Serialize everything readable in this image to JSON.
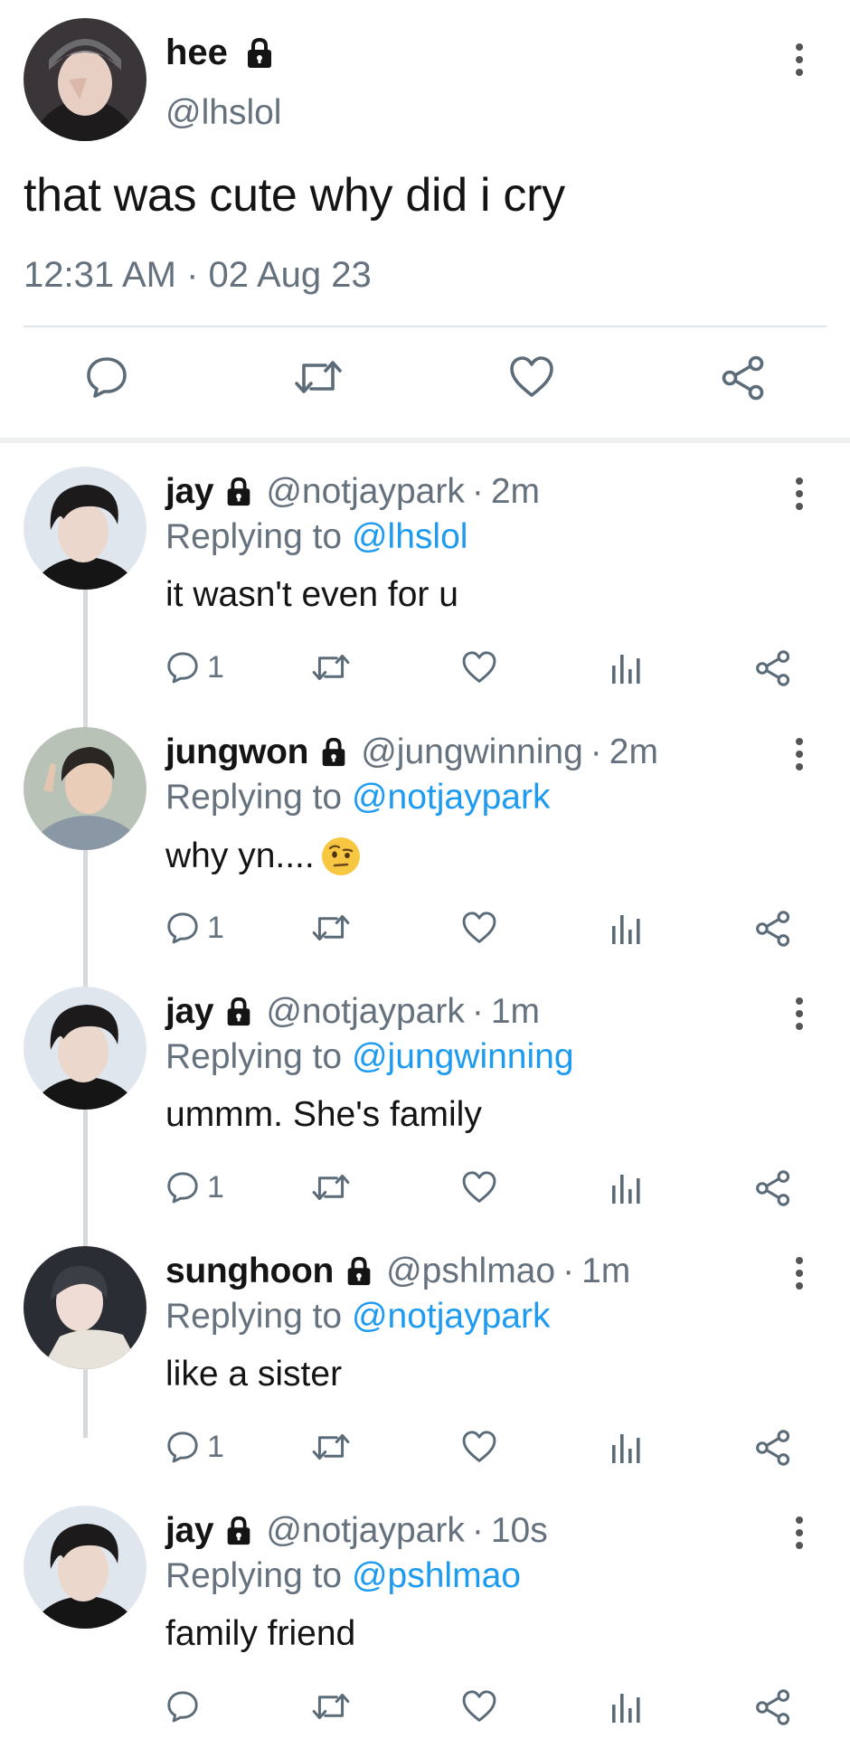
{
  "main_tweet": {
    "name": "hee",
    "handle": "@lhslol",
    "text": "that was cute why did i cry",
    "timestamp": "12:31 AM · 02 Aug 23",
    "icons": [
      "more-vertical-icon",
      "lock-icon",
      "reply-icon",
      "retweet-icon",
      "like-icon",
      "share-icon"
    ]
  },
  "replies": [
    {
      "name": "jay",
      "handle": "@notjaypark",
      "time": "2m",
      "replying_prefix": "Replying to ",
      "replying_to": "@lhslol",
      "text": "it wasn't even for u",
      "reply_count": "1"
    },
    {
      "name": "jungwon",
      "handle": "@jungwinning",
      "time": "2m",
      "replying_prefix": "Replying to ",
      "replying_to": "@notjaypark",
      "text": "why yn....",
      "emoji": "raised-eyebrow-emoji",
      "reply_count": "1"
    },
    {
      "name": "jay",
      "handle": "@notjaypark",
      "time": "1m",
      "replying_prefix": "Replying to ",
      "replying_to": "@jungwinning",
      "text": "ummm. She's family",
      "reply_count": "1"
    },
    {
      "name": "sunghoon",
      "handle": "@pshlmao",
      "time": "1m",
      "replying_prefix": "Replying to ",
      "replying_to": "@notjaypark",
      "text": "like a sister",
      "reply_count": "1"
    },
    {
      "name": "jay",
      "handle": "@notjaypark",
      "time": "10s",
      "replying_prefix": "Replying to ",
      "replying_to": "@pshlmao",
      "text": "family friend",
      "reply_count": ""
    }
  ],
  "colors": {
    "text": "#141414",
    "secondary": "#65727e",
    "mention": "#1d9bf0",
    "divider": "#e1e5e8",
    "thread_line": "#d6d9dc"
  }
}
